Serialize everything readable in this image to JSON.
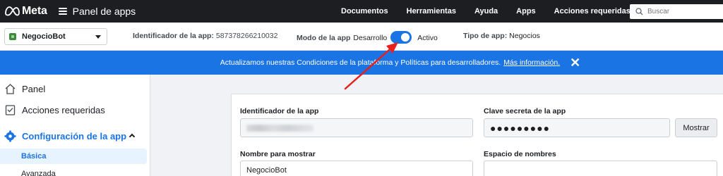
{
  "topbar": {
    "logo_text": "Meta",
    "title": "Panel de apps",
    "nav": [
      "Documentos",
      "Herramientas",
      "Ayuda",
      "Apps",
      "Acciones requeridas"
    ],
    "search_placeholder": "Buscar"
  },
  "app_bar": {
    "selected_app": "NegocioBot",
    "id_label": "Identificador de la app:",
    "id_value": "587378266210032",
    "mode_label": "Modo de la app",
    "mode_dev": "Desarrollo",
    "mode_active": "Activo",
    "mode_is_live": true,
    "type_label": "Tipo de app:",
    "type_value": "Negocios"
  },
  "banner": {
    "message": "Actualizamos nuestras Condiciones de la plataforma y Políticas para desarrolladores.",
    "link": "Más información."
  },
  "sidebar": {
    "items": [
      {
        "label": "Panel",
        "icon": "house-icon"
      },
      {
        "label": "Acciones requeridas",
        "icon": "checklist-icon"
      },
      {
        "label": "Configuración de la app",
        "icon": "gear-icon"
      }
    ],
    "sub_items": [
      "Básica",
      "Avanzada"
    ]
  },
  "form": {
    "app_id_label": "Identificador de la app",
    "app_secret_label": "Clave secreta de la app",
    "app_secret_value": "●●●●●●●●●",
    "show_button": "Mostrar",
    "display_name_label": "Nombre para mostrar",
    "display_name_value": "NegocioBot",
    "namespace_label": "Espacio de nombres",
    "namespace_value": ""
  },
  "colors": {
    "accent": "#1b74e4",
    "topbar": "#1c1e21",
    "annotation_arrow": "#e8201b"
  }
}
